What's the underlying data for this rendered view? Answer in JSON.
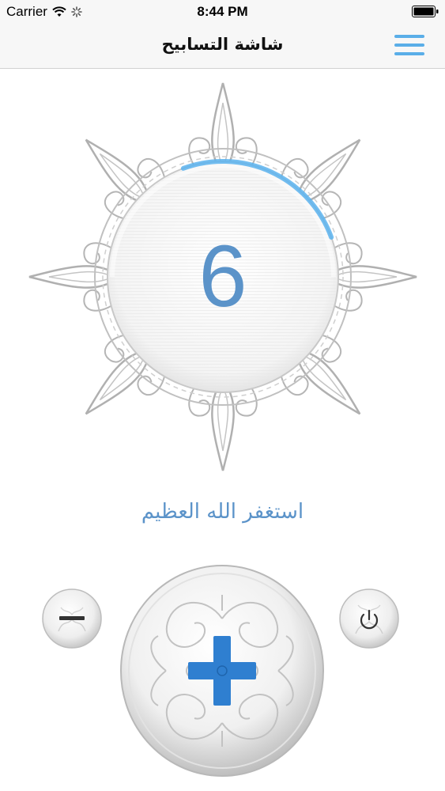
{
  "status_bar": {
    "carrier": "Carrier",
    "time": "8:44 PM"
  },
  "nav": {
    "title": "شاشة التسابيح",
    "menu_icon": "hamburger-menu-icon"
  },
  "counter": {
    "value": "6",
    "progress": 0.25
  },
  "dhikr": {
    "text": "استغفر الله العظيم"
  },
  "buttons": {
    "decrement_icon": "minus-icon",
    "increment_icon": "plus-icon",
    "reset_icon": "power-icon"
  },
  "colors": {
    "accent": "#5b93c9",
    "plus": "#2f7fd0",
    "ornament": "#b0b0b0"
  }
}
